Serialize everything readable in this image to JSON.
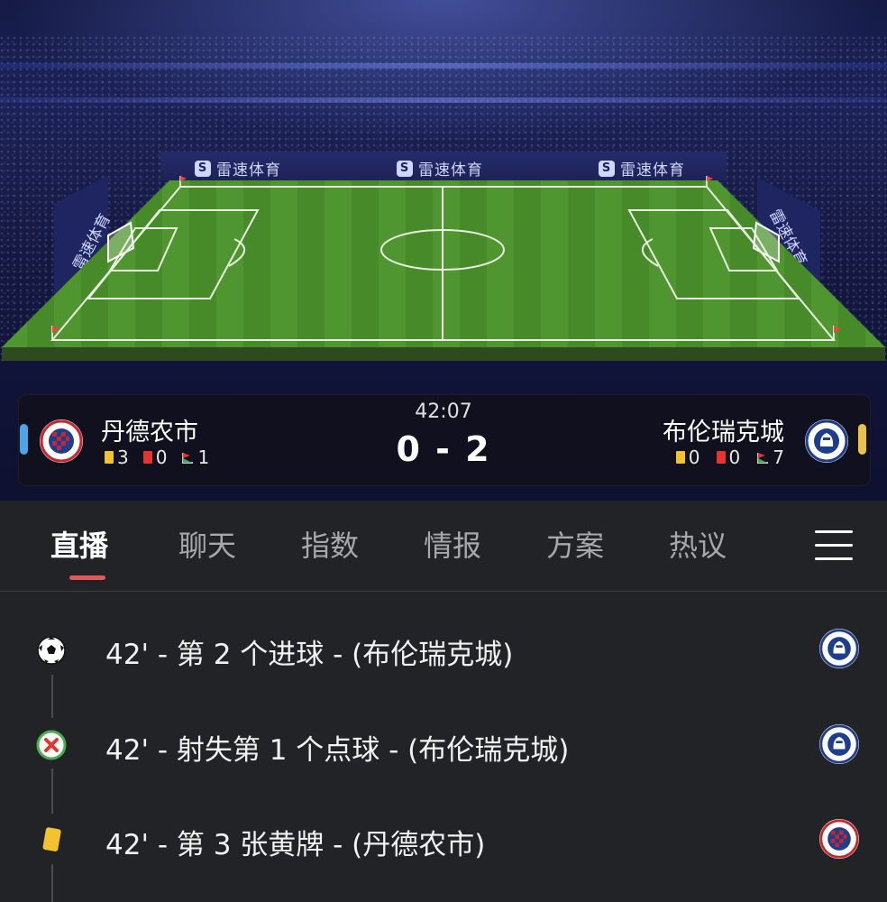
{
  "stadium": {
    "brand_text": "雷速体育"
  },
  "match": {
    "time": "42:07",
    "score": "0 - 2",
    "home": {
      "name": "丹德农市",
      "logo_text": "DANDENONG CITY S.C.",
      "yellow_cards": "3",
      "red_cards": "0",
      "corners": "1",
      "accent_color": "#4aa6e8"
    },
    "away": {
      "name": "布伦瑞克城",
      "logo_text": "BRUNSWICK CITY SOCCER CLUB",
      "yellow_cards": "0",
      "red_cards": "0",
      "corners": "7",
      "accent_color": "#e9c24c"
    }
  },
  "tabs": [
    {
      "label": "直播",
      "active": true
    },
    {
      "label": "聊天",
      "active": false
    },
    {
      "label": "指数",
      "active": false
    },
    {
      "label": "情报",
      "active": false
    },
    {
      "label": "方案",
      "active": false
    },
    {
      "label": "热议",
      "active": false
    }
  ],
  "menu_icon": "hamburger-menu-icon",
  "events": [
    {
      "text": "42' - 第 2 个进球 - (布伦瑞克城)",
      "icon": "soccer-ball-icon",
      "team": "away"
    },
    {
      "text": "42' - 射失第 1 个点球 - (布伦瑞克城)",
      "icon": "missed-penalty-icon",
      "team": "away"
    },
    {
      "text": "42' - 第 3 张黄牌 - (丹德农市)",
      "icon": "yellow-card-icon",
      "team": "home"
    }
  ],
  "colors": {
    "background": "#222326",
    "tab_active_underline": "#e05a5a",
    "yellow_card": "#f2c230",
    "red_card": "#e8342f",
    "pitch": "#4b8f2c"
  }
}
